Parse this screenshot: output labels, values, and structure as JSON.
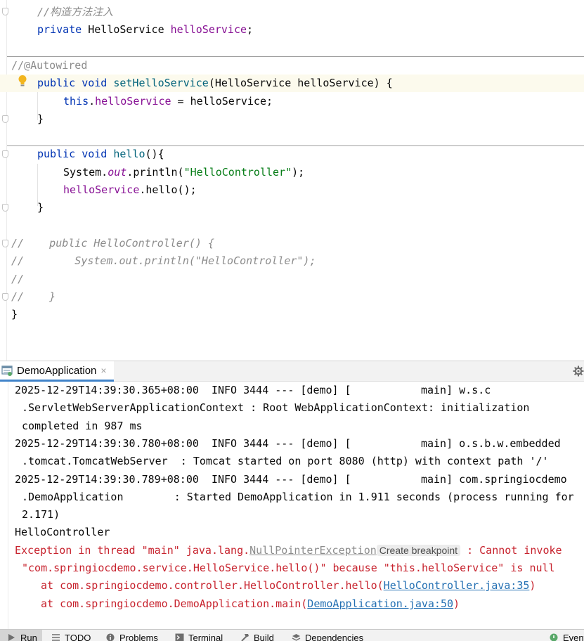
{
  "editor": {
    "lines": [
      {
        "segments": [
          {
            "cls": "cmt",
            "text": "//构造方法注入"
          }
        ]
      },
      {
        "segments": [
          {
            "cls": "kw",
            "text": "private "
          },
          {
            "cls": "",
            "text": "HelloService "
          },
          {
            "cls": "field",
            "text": "helloService"
          },
          {
            "cls": "",
            "text": ";"
          }
        ]
      },
      {
        "segments": []
      },
      {
        "segments": [
          {
            "cls": "anno",
            "text": "//@Autowired"
          }
        ]
      },
      {
        "segments": [
          {
            "cls": "kw",
            "text": "public void "
          },
          {
            "cls": "fn",
            "text": "setHelloService"
          },
          {
            "cls": "",
            "text": "(HelloService helloService) {"
          }
        ]
      },
      {
        "segments": [
          {
            "cls": "kw",
            "text": "this"
          },
          {
            "cls": "",
            "text": "."
          },
          {
            "cls": "field",
            "text": "helloService"
          },
          {
            "cls": "",
            "text": " = helloService;"
          }
        ]
      },
      {
        "segments": [
          {
            "cls": "",
            "text": "}"
          }
        ]
      },
      {
        "segments": []
      },
      {
        "segments": [
          {
            "cls": "kw",
            "text": "public void "
          },
          {
            "cls": "fn",
            "text": "hello"
          },
          {
            "cls": "",
            "text": "(){"
          }
        ]
      },
      {
        "segments": [
          {
            "cls": "",
            "text": "System."
          },
          {
            "cls": "italicfield",
            "text": "out"
          },
          {
            "cls": "",
            "text": ".println("
          },
          {
            "cls": "str",
            "text": "\"HelloController\""
          },
          {
            "cls": "",
            "text": ");"
          }
        ]
      },
      {
        "segments": [
          {
            "cls": "field",
            "text": "helloService"
          },
          {
            "cls": "",
            "text": ".hello();"
          }
        ]
      },
      {
        "segments": [
          {
            "cls": "",
            "text": "}"
          }
        ]
      },
      {
        "segments": []
      },
      {
        "segments": [
          {
            "cls": "cmt",
            "text": "//    public HelloController() {"
          }
        ]
      },
      {
        "segments": [
          {
            "cls": "cmt",
            "text": "//        System.out.println(\"HelloController\");"
          }
        ]
      },
      {
        "segments": [
          {
            "cls": "cmt",
            "text": "//"
          }
        ]
      },
      {
        "segments": [
          {
            "cls": "cmt",
            "text": "//    }"
          }
        ]
      },
      {
        "segments": [
          {
            "cls": "",
            "text": "}"
          }
        ]
      }
    ]
  },
  "run_panel": {
    "tab_label": "DemoApplication",
    "close_glyph": "×"
  },
  "console": {
    "lines": [
      {
        "indent": 0,
        "err": false,
        "segments": [
          {
            "cls": "",
            "text": "2025-12-29T14:39:30.365+08:00  INFO 3444 --- [demo] [           main] w.s.c"
          }
        ]
      },
      {
        "indent": 1,
        "err": false,
        "segments": [
          {
            "cls": "",
            "text": ".ServletWebServerApplicationContext : Root WebApplicationContext: initialization"
          }
        ]
      },
      {
        "indent": 1,
        "err": false,
        "segments": [
          {
            "cls": "",
            "text": "completed in 987 ms"
          }
        ]
      },
      {
        "indent": 0,
        "err": false,
        "segments": [
          {
            "cls": "",
            "text": "2025-12-29T14:39:30.780+08:00  INFO 3444 --- [demo] [           main] o.s.b.w.embedded"
          }
        ]
      },
      {
        "indent": 1,
        "err": false,
        "segments": [
          {
            "cls": "",
            "text": ".tomcat.TomcatWebServer  : Tomcat started on port 8080 (http) with context path '/'"
          }
        ]
      },
      {
        "indent": 0,
        "err": false,
        "segments": [
          {
            "cls": "",
            "text": "2025-12-29T14:39:30.789+08:00  INFO 3444 --- [demo] [           main] com.springiocdemo"
          }
        ]
      },
      {
        "indent": 1,
        "err": false,
        "segments": [
          {
            "cls": "",
            "text": ".DemoApplication        : Started DemoApplication in 1.911 seconds (process running for"
          }
        ]
      },
      {
        "indent": 1,
        "err": false,
        "segments": [
          {
            "cls": "",
            "text": "2.171)"
          }
        ]
      },
      {
        "indent": 0,
        "err": false,
        "segments": [
          {
            "cls": "",
            "text": "HelloController"
          }
        ]
      },
      {
        "indent": 0,
        "err": true,
        "segments": [
          {
            "cls": "",
            "text": "Exception in thread \"main\" java.lang."
          },
          {
            "cls": "npe",
            "text": "NullPointerException"
          },
          {
            "cls": "bp",
            "text": "Create breakpoint"
          },
          {
            "cls": "",
            "text": " : Cannot invoke"
          }
        ]
      },
      {
        "indent": 1,
        "err": true,
        "segments": [
          {
            "cls": "",
            "text": "\"com.springiocdemo.service.HelloService.hello()\" because \"this.helloService\" is null"
          }
        ]
      },
      {
        "indent": 2,
        "err": true,
        "segments": [
          {
            "cls": "",
            "text": "at com.springiocdemo.controller.HelloController.hello("
          },
          {
            "cls": "link",
            "text": "HelloController.java:35"
          },
          {
            "cls": "",
            "text": ")"
          }
        ]
      },
      {
        "indent": 2,
        "err": true,
        "segments": [
          {
            "cls": "",
            "text": "at com.springiocdemo.DemoApplication.main("
          },
          {
            "cls": "link",
            "text": "DemoApplication.java:50"
          },
          {
            "cls": "",
            "text": ")"
          }
        ]
      }
    ]
  },
  "toolbar": {
    "items": [
      {
        "name": "run",
        "label": "Run",
        "icon": "play-icon",
        "active": true
      },
      {
        "name": "todo",
        "label": "TODO",
        "icon": "list-icon",
        "active": false
      },
      {
        "name": "problems",
        "label": "Problems",
        "icon": "info-icon",
        "active": false
      },
      {
        "name": "terminal",
        "label": "Terminal",
        "icon": "terminal-icon",
        "active": false
      },
      {
        "name": "build",
        "label": "Build",
        "icon": "hammer-icon",
        "active": false
      },
      {
        "name": "dependencies",
        "label": "Dependencies",
        "icon": "layers-icon",
        "active": false
      },
      {
        "name": "event-log",
        "label": "Event",
        "icon": "event-log-icon",
        "active": false
      }
    ]
  },
  "colors": {
    "keyword": "#0033b3",
    "comment": "#8c8c8c",
    "field": "#871094",
    "method": "#00627a",
    "string": "#067d17",
    "error": "#c7222d",
    "link": "#2470b3",
    "current_line": "#fcfaed",
    "tab_underline": "#4083c9"
  }
}
